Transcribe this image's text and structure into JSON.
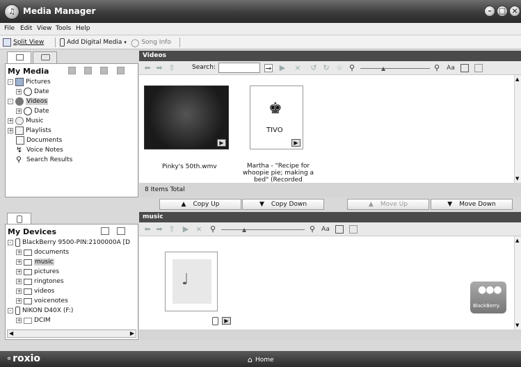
{
  "window": {
    "title": "Media Manager"
  },
  "menu": [
    "File",
    "Edit",
    "View",
    "Tools",
    "Help"
  ],
  "toolbar": {
    "split_view": "Split View",
    "add_media": "Add Digital Media",
    "song_info": "Song Info"
  },
  "my_media": {
    "header": "My Media",
    "tree": [
      {
        "label": "Pictures"
      },
      {
        "label": "Date"
      },
      {
        "label": "Videos"
      },
      {
        "label": "Date"
      },
      {
        "label": "Music"
      },
      {
        "label": "Playlists"
      },
      {
        "label": "Documents"
      },
      {
        "label": "Voice Notes"
      },
      {
        "label": "Search Results"
      }
    ]
  },
  "videos": {
    "title": "Videos",
    "search_label": "Search:",
    "search_value": "",
    "items": [
      {
        "name": "Pinky's 50th.wmv"
      },
      {
        "name": "Martha - \"Recipe for whoopie pie; making a bed\" (Recorded",
        "file_label": "TIVO"
      }
    ],
    "total": "8 Items Total"
  },
  "pane_buttons": {
    "copy_up": "Copy Up",
    "copy_down": "Copy Down",
    "move_up": "Move Up",
    "move_down": "Move Down"
  },
  "my_devices": {
    "header": "My Devices",
    "tree": [
      {
        "label": "BlackBerry 9500-PIN:2100000A [D"
      },
      {
        "label": "documents"
      },
      {
        "label": "music"
      },
      {
        "label": "pictures"
      },
      {
        "label": "ringtones"
      },
      {
        "label": "videos"
      },
      {
        "label": "voicenotes"
      },
      {
        "label": "NIKON D40X (F:)"
      },
      {
        "label": "DCIM"
      }
    ]
  },
  "music": {
    "title": "music"
  },
  "blackberry_logo": {
    "text": "BlackBerry."
  },
  "bottom": {
    "brand": "roxio",
    "home": "Home"
  },
  "colors": {
    "titlebar": "#3c3c3c",
    "section_header": "#4a4a4a",
    "selection": "#cfcfcf"
  }
}
